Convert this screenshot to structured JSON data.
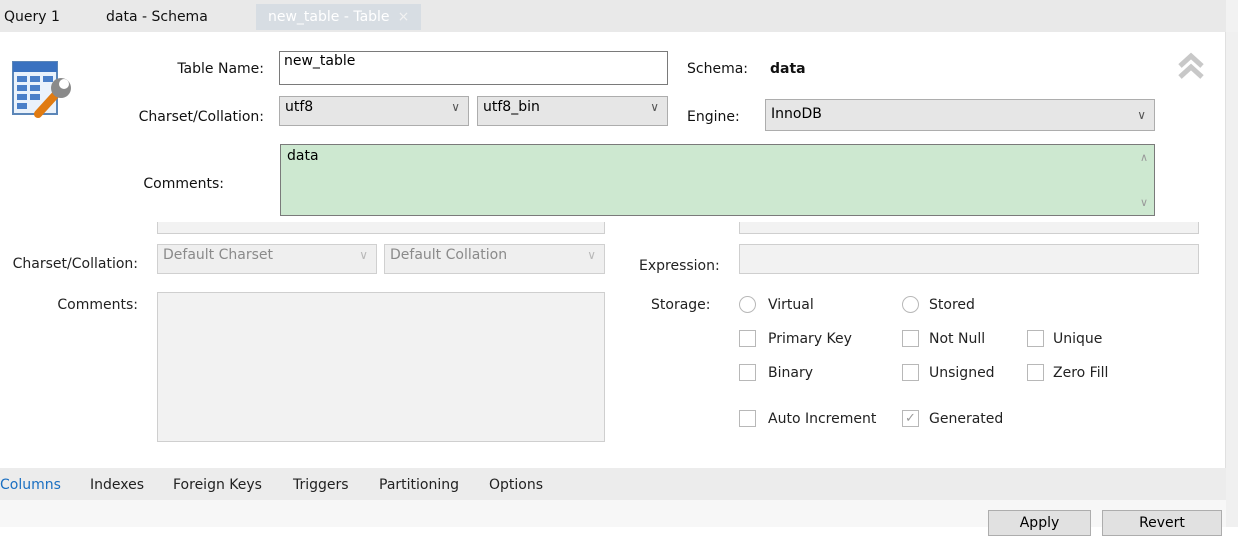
{
  "tabs": [
    {
      "label": "Query 1"
    },
    {
      "label": "data - Schema"
    },
    {
      "label": "new_table - Table",
      "close": "×"
    }
  ],
  "table": {
    "name_label": "Table Name:",
    "name_value": "new_table",
    "schema_label": "Schema:",
    "schema_value": "data",
    "charset_label": "Charset/Collation:",
    "charset_value": "utf8",
    "collation_value": "utf8_bin",
    "engine_label": "Engine:",
    "engine_value": "InnoDB",
    "comments_label": "Comments:",
    "comments_value": "data"
  },
  "column": {
    "charset_label": "Charset/Collation:",
    "charset_placeholder": "Default Charset",
    "collation_placeholder": "Default Collation",
    "comments_label": "Comments:",
    "expression_label": "Expression:",
    "storage_label": "Storage:",
    "storage_options": [
      "Virtual",
      "Stored"
    ],
    "flags": {
      "primary_key": "Primary Key",
      "not_null": "Not Null",
      "unique": "Unique",
      "binary": "Binary",
      "unsigned": "Unsigned",
      "zero_fill": "Zero Fill",
      "auto_increment": "Auto Increment",
      "generated": "Generated"
    }
  },
  "bottom_tabs": [
    "Columns",
    "Indexes",
    "Foreign Keys",
    "Triggers",
    "Partitioning",
    "Options"
  ],
  "buttons": {
    "apply": "Apply",
    "revert": "Revert"
  },
  "icons": {
    "table_editor": "table-wrench-icon",
    "collapse": "double-chevron-up-icon",
    "dropdown": "chevron-down-icon"
  }
}
